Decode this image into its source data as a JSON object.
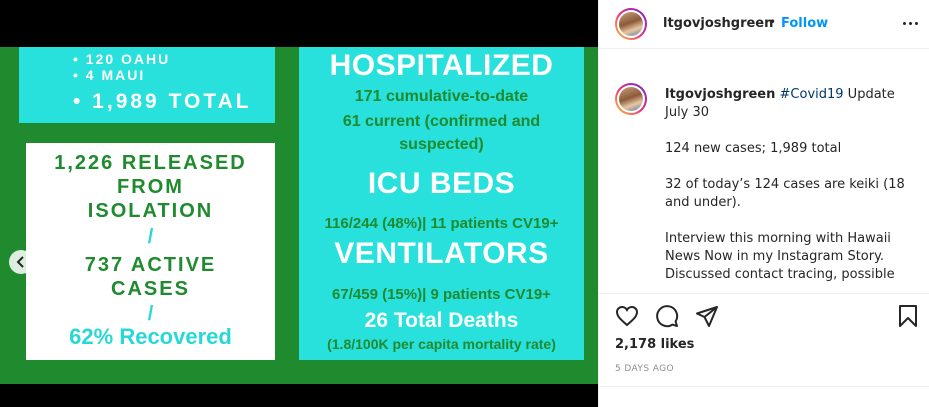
{
  "post": {
    "panel_top": {
      "line1": "• 120 OAHU",
      "line2": "• 4 MAUI",
      "line3": "• 1,989 TOTAL"
    },
    "panel_left": {
      "line1": "1,226 RELEASED",
      "line2": "FROM",
      "line3": "ISOLATION",
      "slash": "/",
      "line4": "737 ACTIVE",
      "line5": "CASES",
      "recovered": "62% Recovered"
    },
    "panel_right": {
      "hospitalized_heading": "HOSPITALIZED",
      "hospitalized_line1": "171 cumulative-to-date",
      "hospitalized_line2": "61 current (confirmed and",
      "hospitalized_line3": "suspected)",
      "icu_heading": "ICU BEDS",
      "icu_line": "116/244 (48%)| 11 patients CV19+",
      "vent_heading": "VENTILATORS",
      "vent_line": "67/459 (15%)| 9 patients CV19+",
      "deaths": "26 Total Deaths",
      "mortality": "(1.8/100K per capita mortality rate)"
    },
    "carousel": {
      "slide_count": 3,
      "active_slide": 3
    }
  },
  "header": {
    "username": "ltgovjoshgreen",
    "separator": "•",
    "follow_label": "Follow"
  },
  "caption": {
    "username": "ltgovjoshgreen",
    "hashtag": "#Covid19",
    "title_rest": " Update",
    "title_line2": "July 30",
    "p1": "124 new cases; 1,989 total",
    "p2": "32 of today’s 124 cases are keiki (18 and under).",
    "p3": "Interview this morning with Hawaii News Now in my Instagram Story. Discussed contact tracing, possible"
  },
  "engagement": {
    "likes": "2,178 likes",
    "date": "5 DAYS AGO"
  },
  "icons": {
    "like": "heart-icon",
    "comment": "comment-icon",
    "share": "paper-plane-icon",
    "save": "bookmark-icon",
    "prev": "chevron-left-icon",
    "more": "more-horizontal-icon"
  },
  "colors": {
    "green": "#1f8a2e",
    "cyan": "#28e0dc",
    "link_blue": "#0095f6",
    "hashtag": "#00376b"
  }
}
